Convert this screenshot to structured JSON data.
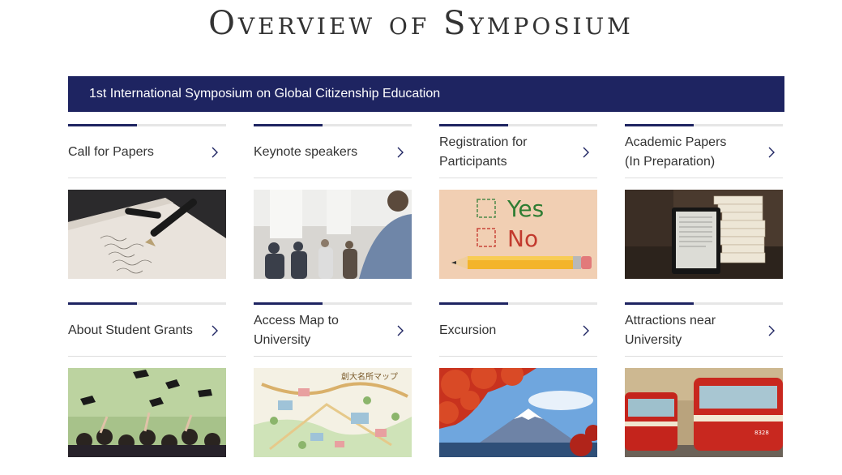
{
  "page": {
    "title": "Overview of Symposium"
  },
  "banner": {
    "text": "1st International Symposium on Global Citizenship Education"
  },
  "cards": [
    {
      "label": "Call for Papers",
      "icon": "chevron-right-icon",
      "image": "fountain-pen-writing-image"
    },
    {
      "label": "Keynote speakers",
      "icon": "chevron-right-icon",
      "image": "lecture-audience-image"
    },
    {
      "label": "Registration for\nParticipants",
      "icon": "chevron-right-icon",
      "image": "yes-no-checkbox-pencil-image",
      "image_text": {
        "yes": "Yes",
        "no": "No"
      }
    },
    {
      "label": "Academic Papers\n(In Preparation)",
      "icon": "chevron-right-icon",
      "image": "ebook-reader-books-image"
    },
    {
      "label": "About Student Grants",
      "icon": "chevron-right-icon",
      "image": "graduation-caps-toss-image"
    },
    {
      "label": "Access Map to\nUniversity",
      "icon": "chevron-right-icon",
      "image": "campus-map-image",
      "image_text": {
        "map_title": "創大名所マップ"
      }
    },
    {
      "label": "Excursion",
      "icon": "chevron-right-icon",
      "image": "mount-fuji-autumn-image"
    },
    {
      "label": "Attractions near\nUniversity",
      "icon": "chevron-right-icon",
      "image": "red-trams-image",
      "image_text": {
        "tram_number": "8328"
      }
    }
  ],
  "colors": {
    "navy": "#1e2461",
    "divider": "#dddddd",
    "text": "#333333"
  }
}
